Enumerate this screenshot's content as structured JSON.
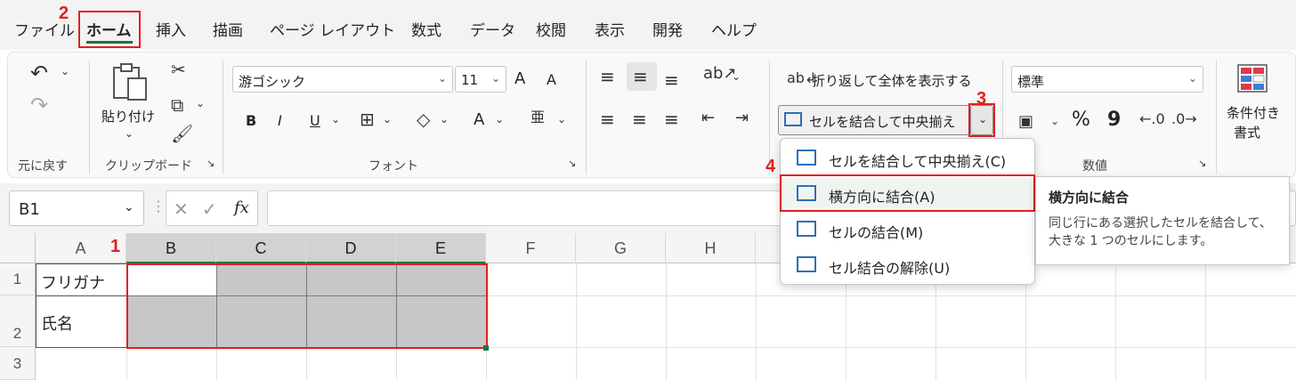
{
  "tabs": [
    "ファイル",
    "ホーム",
    "挿入",
    "描画",
    "ページ レイアウト",
    "数式",
    "データ",
    "校閲",
    "表示",
    "開発",
    "ヘルプ"
  ],
  "steps": [
    "1",
    "2",
    "3",
    "4"
  ],
  "ribbon": {
    "undo_group_label": "元に戻す",
    "clipboard": {
      "paste_label": "貼り付け",
      "group_label": "クリップボード"
    },
    "font": {
      "name": "游ゴシック",
      "size": "11",
      "group_label": "フォント",
      "bold": "B",
      "italic": "I",
      "underline": "U",
      "font_color": "A",
      "grow": "A",
      "shrink": "A"
    },
    "alignment": {
      "wrap_text_label": "折り返して全体を表示する",
      "merge_center_label": "セルを結合して中央揃え"
    },
    "number": {
      "format": "標準",
      "percent": "%",
      "comma": "9",
      "group_label": "数値"
    },
    "styles": {
      "conditional_format_line1": "条件付き",
      "conditional_format_line2": "書式"
    }
  },
  "formula_bar": {
    "name_box": "B1",
    "fx": "fx"
  },
  "columns": [
    "A",
    "B",
    "C",
    "D",
    "E",
    "F",
    "G",
    "H"
  ],
  "rows": [
    "1",
    "2",
    "3"
  ],
  "cells": {
    "A1": "フリガナ",
    "A2": "氏名"
  },
  "merge_menu": {
    "items": [
      "セルを結合して中央揃え(C)",
      "横方向に結合(A)",
      "セルの結合(M)",
      "セル結合の解除(U)"
    ]
  },
  "tooltip": {
    "title": "横方向に結合",
    "body": "同じ行にある選択したセルを結合して、大きな 1 つのセルにします。"
  },
  "colors": {
    "accent": "#1e7145",
    "highlight": "#e02020",
    "selection_fill": "#c7c7c7"
  }
}
